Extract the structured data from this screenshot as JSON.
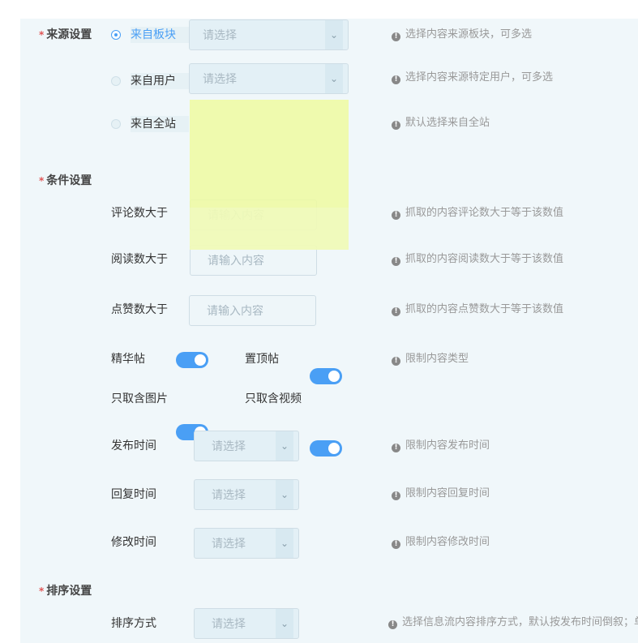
{
  "source_section": {
    "title": "来源设置",
    "required_mark": "*",
    "options": [
      {
        "label": "来自板块",
        "selected": true,
        "select_placeholder": "请选择",
        "hint": "选择内容来源板块，可多选"
      },
      {
        "label": "来自用户",
        "selected": false,
        "select_placeholder": "请选择",
        "hint": "选择内容来源特定用户，可多选"
      },
      {
        "label": "来自全站",
        "selected": false,
        "hint": "默认选择来自全站"
      }
    ]
  },
  "condition_section": {
    "title": "条件设置",
    "required_mark": "*",
    "inputs": [
      {
        "label": "评论数大于",
        "placeholder": "请输入内容",
        "hint": "抓取的内容评论数大于等于该数值"
      },
      {
        "label": "阅读数大于",
        "placeholder": "请输入内容",
        "hint": "抓取的内容阅读数大于等于该数值"
      },
      {
        "label": "点赞数大于",
        "placeholder": "请输入内容",
        "hint": "抓取的内容点赞数大于等于该数值"
      }
    ],
    "toggles": [
      {
        "label": "精华帖",
        "on": true
      },
      {
        "label": "置顶帖",
        "on": true
      },
      {
        "label": "只取含图片",
        "on": true
      },
      {
        "label": "只取含视频",
        "on": true
      }
    ],
    "toggles_hint": "限制内容类型",
    "time_filters": [
      {
        "label": "发布时间",
        "placeholder": "请选择",
        "hint": "限制内容发布时间"
      },
      {
        "label": "回复时间",
        "placeholder": "请选择",
        "hint": "限制内容回复时间"
      },
      {
        "label": "修改时间",
        "placeholder": "请选择",
        "hint": "限制内容修改时间"
      }
    ]
  },
  "sort_section": {
    "title": "排序设置",
    "required_mark": "*",
    "label": "排序方式",
    "placeholder": "请选择",
    "hint": "选择信息流内容排序方式，默认按发布时间倒叙；单"
  },
  "icons": {
    "info": "!",
    "chevron": "⌄"
  },
  "colors": {
    "accent": "#4a9ff5",
    "required": "#e05555",
    "panel_bg": "#f0f7fa",
    "highlight": "#eefaa0"
  }
}
